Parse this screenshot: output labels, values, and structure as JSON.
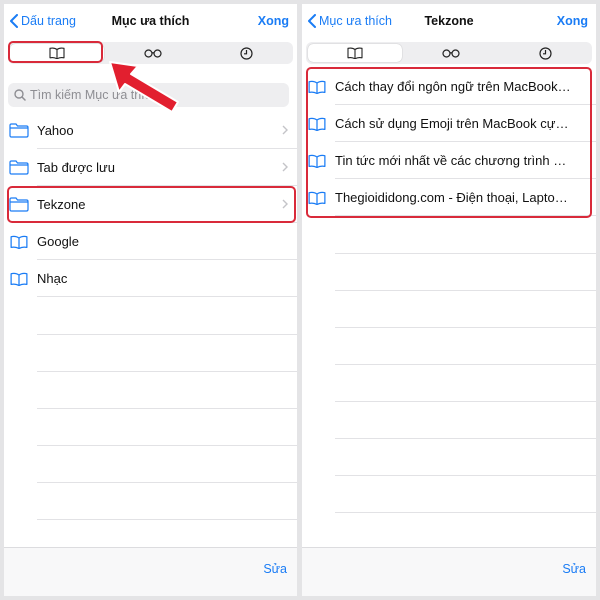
{
  "left_screen": {
    "back_label": "Dấu trang",
    "title": "Mục ưa thích",
    "done_label": "Xong",
    "tabs": [
      {
        "icon": "book-icon",
        "selected": true
      },
      {
        "icon": "glasses-icon",
        "selected": false
      },
      {
        "icon": "clock-icon",
        "selected": false
      }
    ],
    "search_placeholder": "Tìm kiếm Mục ưa thích",
    "items": [
      {
        "label": "Yahoo",
        "icon": "folder-icon",
        "has_chevron": true
      },
      {
        "label": "Tab được lưu",
        "icon": "folder-icon",
        "has_chevron": true
      },
      {
        "label": "Tekzone",
        "icon": "folder-icon",
        "has_chevron": true
      },
      {
        "label": "Google",
        "icon": "book-icon",
        "has_chevron": false
      },
      {
        "label": "Nhạc",
        "icon": "book-icon",
        "has_chevron": false
      }
    ],
    "edit_label": "Sửa"
  },
  "right_screen": {
    "back_label": "Mục ưa thích",
    "title": "Tekzone",
    "done_label": "Xong",
    "tabs": [
      {
        "icon": "book-icon",
        "selected": true
      },
      {
        "icon": "glasses-icon",
        "selected": false
      },
      {
        "icon": "clock-icon",
        "selected": false
      }
    ],
    "items": [
      {
        "label": "Cách thay đổi ngôn ngữ trên MacBook cực đơn giản",
        "icon": "book-icon"
      },
      {
        "label": "Cách sử dụng Emoji trên MacBook cực đơn giản",
        "icon": "book-icon"
      },
      {
        "label": "Tin tức mới nhất về các chương trình khuyến mãi",
        "icon": "book-icon"
      },
      {
        "label": "Thegioididong.com - Điện thoại, Laptop, Tablet",
        "icon": "book-icon"
      }
    ],
    "edit_label": "Sửa"
  },
  "colors": {
    "accent": "#1a7cf5",
    "highlight": "#d92a3a",
    "arrow": "#e21f2f"
  }
}
